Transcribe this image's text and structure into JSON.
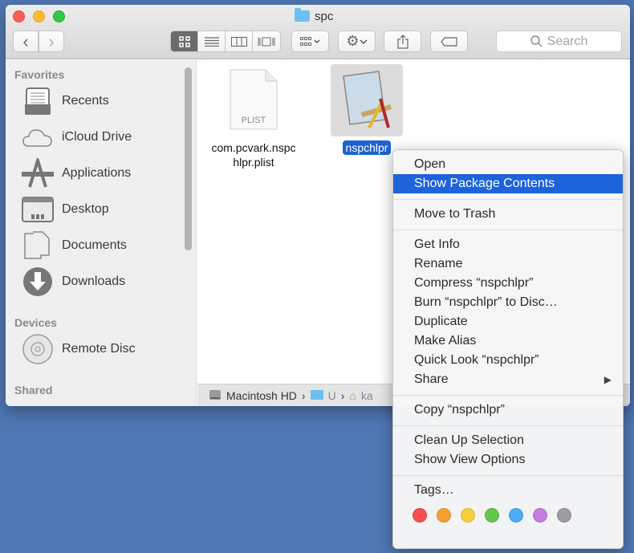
{
  "window": {
    "title": "spc",
    "toolbar": {
      "back": "‹",
      "forward": "›",
      "view_modes": [
        "icon",
        "list",
        "column",
        "gallery"
      ],
      "active_view": "icon",
      "search_placeholder": "Search"
    }
  },
  "sidebar": {
    "sections": [
      {
        "title": "Favorites",
        "items": [
          "Recents",
          "iCloud Drive",
          "Applications",
          "Desktop",
          "Documents",
          "Downloads"
        ]
      },
      {
        "title": "Devices",
        "items": [
          "Remote Disc"
        ]
      },
      {
        "title": "Shared",
        "items": []
      }
    ]
  },
  "files": [
    {
      "name": "com.pcvark.nspc\nhlpr.plist",
      "name_line1": "com.pcvark.nspc",
      "name_line2": "hlpr.plist",
      "badge": "PLIST",
      "selected": false
    },
    {
      "name": "nspchlpr",
      "selected": true
    }
  ],
  "pathbar": [
    "Macintosh HD",
    "U",
    "ka"
  ],
  "context_menu": {
    "groups": [
      [
        "Open",
        "Show Package Contents"
      ],
      [
        "Move to Trash"
      ],
      [
        "Get Info",
        "Rename",
        "Compress “nspchlpr”",
        "Burn “nspchlpr” to Disc…",
        "Duplicate",
        "Make Alias",
        "Quick Look “nspchlpr”",
        "Share"
      ],
      [
        "Copy “nspchlpr”"
      ],
      [
        "Clean Up Selection",
        "Show View Options"
      ],
      [
        "Tags…"
      ]
    ],
    "highlighted": "Show Package Contents",
    "tag_colors": [
      "#f64e4e",
      "#f7a030",
      "#f5d03a",
      "#62c84a",
      "#4baef2",
      "#c77ddf",
      "#9d9d9f"
    ]
  }
}
